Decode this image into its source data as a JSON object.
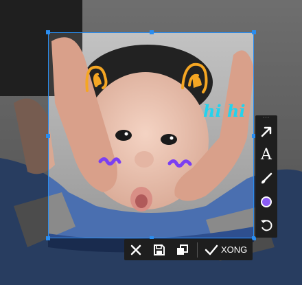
{
  "toolbar": {
    "arrow_tool": "arrow-tool",
    "text_tool_glyph": "A",
    "brush_tool": "brush-tool",
    "color_swatch": "#8b5cf6",
    "undo_tool": "undo-tool"
  },
  "actions": {
    "cancel_icon": "close-icon",
    "save_icon": "save-icon",
    "copy_icon": "copy-icon",
    "done_label": "XONG"
  },
  "annotations": {
    "doodle_text": "hi hi",
    "ear_color": "#f5a623",
    "blush_color": "#7b3ff2",
    "text_color": "#22d3ee"
  }
}
